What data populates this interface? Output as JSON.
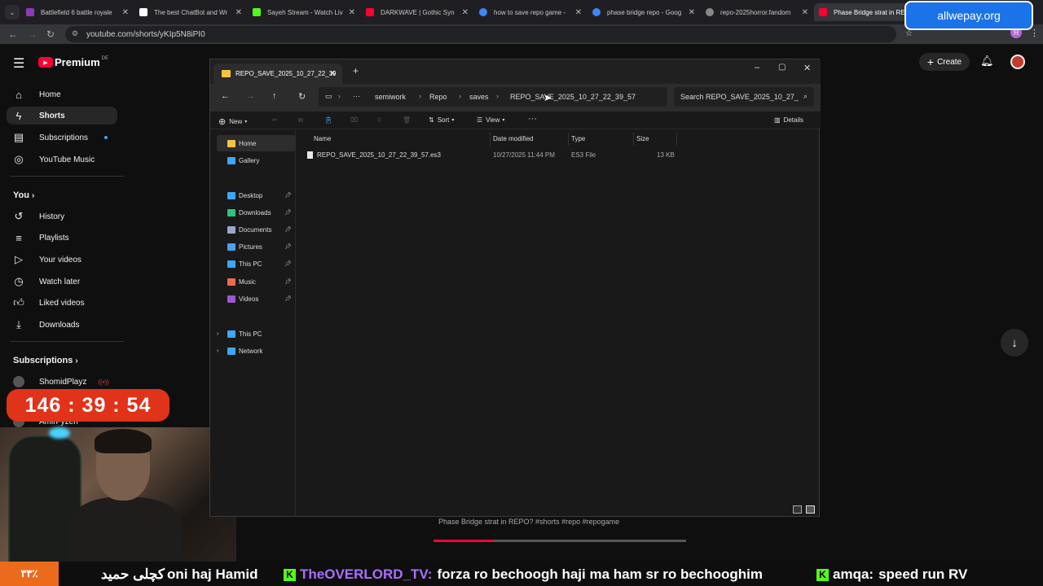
{
  "browser": {
    "tabs": [
      {
        "title": "Battlefield 6 battle royale",
        "color": "#8a3ab9"
      },
      {
        "title": "The best ChatBot and Wr",
        "color": "#ffffff"
      },
      {
        "title": "Sayeh Stream - Watch Liv",
        "color": "#53fc18"
      },
      {
        "title": "DARKWAVE | Gothic Syn",
        "color": "#ff0033"
      },
      {
        "title": "how to save repo game -",
        "color": "#4285f4"
      },
      {
        "title": "phase bridge repo - Goog",
        "color": "#4285f4"
      },
      {
        "title": "repo-2025horror.fandom",
        "color": "#888888"
      },
      {
        "title": "Phase Bridge strat in REPO",
        "color": "#ff0033"
      }
    ],
    "url": "youtube.com/shorts/yKIp5N8iPI0",
    "overlay_banner": "allwepay.org"
  },
  "youtube": {
    "logo": "Premium",
    "logo_sup": "DE",
    "create_label": "Create",
    "nav": [
      "Home",
      "Shorts",
      "Subscriptions",
      "YouTube Music"
    ],
    "you_label": "You",
    "you_items": [
      "History",
      "Playlists",
      "Your videos",
      "Watch later",
      "Liked videos",
      "Downloads"
    ],
    "subs_label": "Subscriptions",
    "subs_items": [
      "ShomidPlayz",
      "AmirFyzeh"
    ],
    "short_caption": "Phase Bridge strat in REPO? #shorts #repo #repogame",
    "progress_fraction": 0.24
  },
  "stream": {
    "timer": "146 : 39 : 54",
    "ticker_badge": "۳۳٪",
    "ticker_text_1": "کچلی حمید",
    "ticker_text_2": "oni haj Hamid",
    "ticker_user_1": "TheOVERLORD_TV:",
    "ticker_msg_1": "forza ro bechoogh haji ma ham sr ro bechooghim",
    "ticker_user_2": "amqa:",
    "ticker_msg_2": "speed run RV"
  },
  "explorer": {
    "tab_title": "REPO_SAVE_2025_10_27_22_39",
    "breadcrumbs": [
      "semiwork",
      "Repo",
      "saves",
      "REPO_SAVE_2025_10_27_22_39_57"
    ],
    "search_placeholder": "Search REPO_SAVE_2025_10_27_",
    "cmd": {
      "new": "New",
      "sort": "Sort",
      "view": "View",
      "more": "···",
      "details": "Details"
    },
    "nav_pane": {
      "home": "Home",
      "gallery": "Gallery",
      "pinned": [
        "Desktop",
        "Downloads",
        "Documents",
        "Pictures",
        "This PC",
        "Music",
        "Videos"
      ],
      "this_pc": "This PC",
      "network": "Network"
    },
    "columns": [
      "Name",
      "Date modified",
      "Type",
      "Size"
    ],
    "files": [
      {
        "name": "REPO_SAVE_2025_10_27_22_39_57.es3",
        "date": "10/27/2025 11:44 PM",
        "type": "ES3 File",
        "size": "13 KB"
      }
    ]
  }
}
